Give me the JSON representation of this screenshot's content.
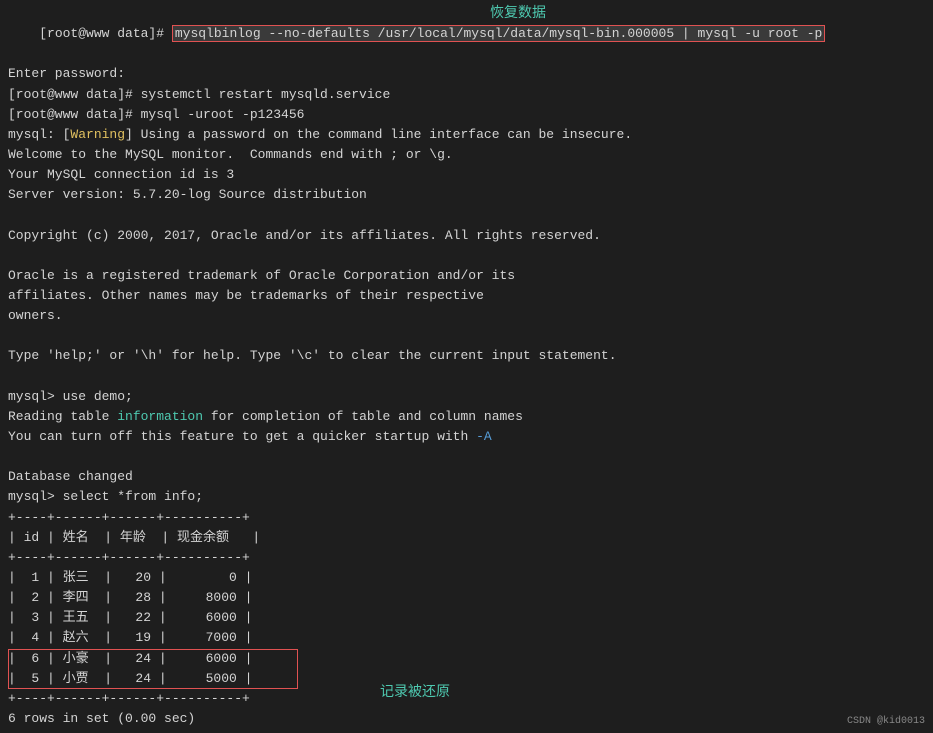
{
  "terminal": {
    "lines": [
      {
        "type": "prompt_cmd",
        "prompt": "[root@www data]# ",
        "cmd_highlight": "mysqlbinlog --no-defaults /usr/local/mysql/data/mysql-bin.000005 | mysql -u root -p"
      },
      {
        "type": "plain",
        "text": "Enter password:"
      },
      {
        "type": "plain",
        "text": "[root@www data]# systemctl restart mysqld.service"
      },
      {
        "type": "prompt_cmd2",
        "text": "[root@www data]# mysql -uroot -p123456"
      },
      {
        "type": "warning",
        "text": "mysql: [Warning] Using a password on the command line interface can be insecure."
      },
      {
        "type": "plain",
        "text": "Welcome to the MySQL monitor.  Commands end with ; or \\g."
      },
      {
        "type": "plain",
        "text": "Your MySQL connection id is 3"
      },
      {
        "type": "plain",
        "text": "Server version: 5.7.20-log Source distribution"
      },
      {
        "type": "blank"
      },
      {
        "type": "plain",
        "text": "Copyright (c) 2000, 2017, Oracle and/or its affiliates. All rights reserved."
      },
      {
        "type": "blank"
      },
      {
        "type": "plain",
        "text": "Oracle is a registered trademark of Oracle Corporation and/or its"
      },
      {
        "type": "plain",
        "text": "affiliates. Other names may be trademarks of their respective"
      },
      {
        "type": "plain",
        "text": "owners."
      },
      {
        "type": "blank"
      },
      {
        "type": "plain",
        "text": "Type 'help;' or '\\h' for help. Type '\\c' to clear the current input statement."
      },
      {
        "type": "blank"
      },
      {
        "type": "plain",
        "text": "mysql> use demo;"
      },
      {
        "type": "reading_table"
      },
      {
        "type": "plain",
        "text": "You can turn off this feature to get a quicker startup with -A"
      },
      {
        "type": "blank"
      },
      {
        "type": "plain",
        "text": "Database changed"
      },
      {
        "type": "plain",
        "text": "mysql> select *from info;"
      },
      {
        "type": "table_divider"
      },
      {
        "type": "table_header"
      },
      {
        "type": "table_divider"
      },
      {
        "type": "table_row",
        "id": "1",
        "name": "张三",
        "age": "20",
        "balance": "0",
        "highlight": false
      },
      {
        "type": "table_row",
        "id": "2",
        "name": "李四",
        "age": "28",
        "balance": "8000",
        "highlight": false
      },
      {
        "type": "table_row",
        "id": "3",
        "name": "王五",
        "age": "22",
        "balance": "6000",
        "highlight": false
      },
      {
        "type": "table_row",
        "id": "4",
        "name": "赵六",
        "age": "19",
        "balance": "7000",
        "highlight": false
      },
      {
        "type": "table_row",
        "id": "6",
        "name": "小豪",
        "age": "24",
        "balance": "6000",
        "highlight": true,
        "pos": "top"
      },
      {
        "type": "table_row",
        "id": "5",
        "name": "小贾",
        "age": "24",
        "balance": "5000",
        "highlight": true,
        "pos": "bottom"
      },
      {
        "type": "table_divider"
      },
      {
        "type": "plain",
        "text": "6 rows in set (0.00 sec)"
      }
    ],
    "annotations": {
      "huifu": "恢复数据",
      "jilu": "记录被还原"
    },
    "watermark": "CSDN @kid0013"
  }
}
